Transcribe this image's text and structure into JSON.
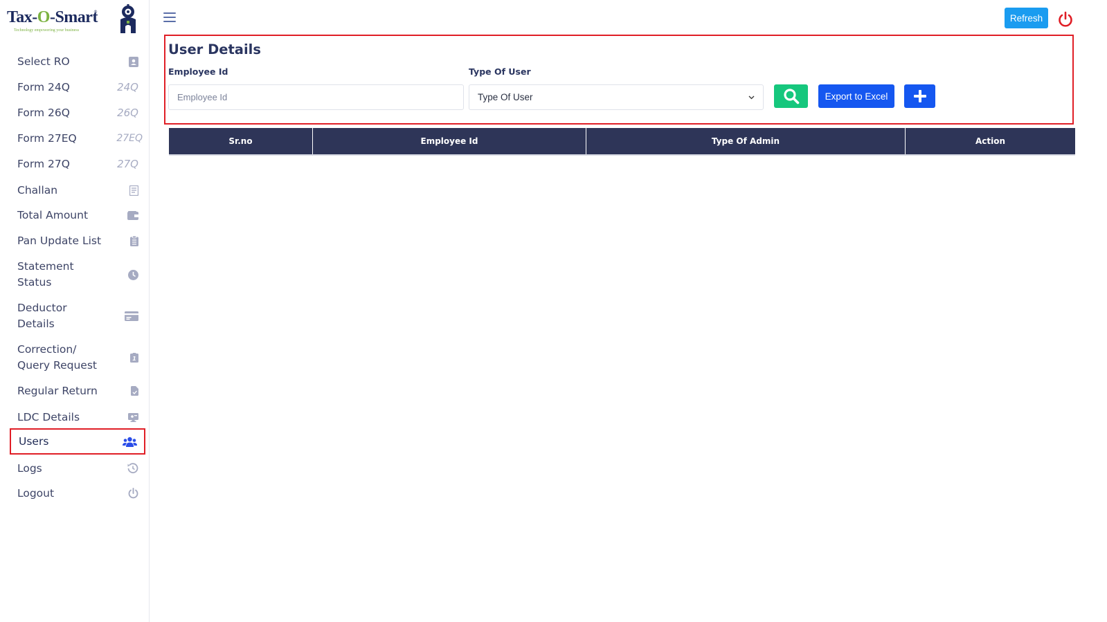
{
  "app": {
    "logo_text_a": "Tax-",
    "logo_text_o": "O",
    "logo_text_b": "-Smart",
    "logo_reg": "®",
    "logo_tagline": "Technology empowering your business"
  },
  "sidebar": {
    "items": [
      {
        "label": "Select RO",
        "icon": "contact-card-icon"
      },
      {
        "label": "Form 24Q",
        "badge": "24Q"
      },
      {
        "label": "Form 26Q",
        "badge": "26Q"
      },
      {
        "label": "Form 27EQ",
        "badge": "27EQ"
      },
      {
        "label": "Form 27Q",
        "badge": "27Q"
      },
      {
        "label": "Challan",
        "icon": "receipt-icon"
      },
      {
        "label": "Total Amount",
        "icon": "wallet-icon"
      },
      {
        "label": "Pan Update List",
        "icon": "clipboard-list-icon"
      },
      {
        "label_line1": "Statement",
        "label_line2": "Status",
        "icon": "clock-icon"
      },
      {
        "label_line1": "Deductor",
        "label_line2": "Details",
        "icon": "id-card-icon"
      },
      {
        "label_line1": "Correction/",
        "label_line2": "Query Request",
        "icon": "query-icon"
      },
      {
        "label": "Regular Return",
        "icon": "file-icon"
      },
      {
        "label": "LDC Details",
        "icon": "monitor-icon"
      },
      {
        "label": "Users",
        "icon": "users-icon",
        "active": true
      },
      {
        "label": "Logs",
        "icon": "history-icon"
      },
      {
        "label": "Logout",
        "icon": "power-icon"
      }
    ]
  },
  "header": {
    "refresh_label": "Refresh"
  },
  "main": {
    "title": "User Details",
    "employee_id_label": "Employee Id",
    "employee_id_placeholder": "Employee Id",
    "employee_id_value": "",
    "type_of_user_label": "Type Of User",
    "type_of_user_selected": "Type Of User",
    "export_label": "Export to Excel",
    "table": {
      "columns": [
        "Sr.no",
        "Employee Id",
        "Type Of Admin",
        "Action"
      ],
      "rows": []
    }
  },
  "colors": {
    "highlight": "#e01e26",
    "header_bg": "#2e3558",
    "search_btn": "#16c77d",
    "primary_btn": "#1557f0",
    "refresh_btn": "#1a9cf0"
  }
}
